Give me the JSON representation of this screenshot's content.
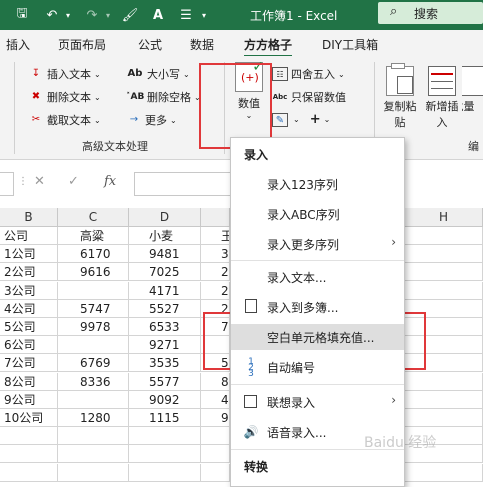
{
  "titlebar": {
    "title": "工作簿1 - Excel",
    "search_label": "搜索",
    "icons": [
      "save-icon",
      "undo-icon",
      "redo-icon",
      "format-painter-icon",
      "text-icon",
      "customize-icon"
    ]
  },
  "tabs": [
    "插入",
    "页面布局",
    "公式",
    "数据",
    "方方格子",
    "DIY工具箱"
  ],
  "ribbon": {
    "text_group": {
      "insert_text": "插入文本",
      "delete_text": "删除文本",
      "truncate_text": "截取文本",
      "case": "大小写",
      "delete_space": "删除空格",
      "more": "更多",
      "label": "高级文本处理"
    },
    "number_group": {
      "numeric": "数值",
      "round": "四舍五入",
      "keep_numeric": "只保留数值"
    },
    "copy_paste": "复制粘贴",
    "new_insert": "新增插入",
    "batch": "批量",
    "edit_label": "编"
  },
  "formula_bar": {
    "fx": "fx"
  },
  "grid": {
    "columns": [
      "B",
      "C",
      "D",
      "",
      "H"
    ],
    "rows": [
      [
        "公司",
        "高粱",
        "小麦",
        "玉"
      ],
      [
        "1公司",
        "6170",
        "9481",
        "3"
      ],
      [
        "2公司",
        "9616",
        "7025",
        "2"
      ],
      [
        "3公司",
        "",
        "4171",
        "2"
      ],
      [
        "4公司",
        "5747",
        "5527",
        "2"
      ],
      [
        "5公司",
        "9978",
        "6533",
        "7"
      ],
      [
        "6公司",
        "",
        "9271",
        ""
      ],
      [
        "7公司",
        "6769",
        "3535",
        "5"
      ],
      [
        "8公司",
        "8336",
        "5577",
        "8"
      ],
      [
        "9公司",
        "",
        "9092",
        "4"
      ],
      [
        "10公司",
        "1280",
        "1115",
        "9"
      ]
    ]
  },
  "menu": {
    "header_input": "录入",
    "items": [
      {
        "label": "录入123序列",
        "icon": ""
      },
      {
        "label": "录入ABC序列",
        "icon": ""
      },
      {
        "label": "录入更多序列",
        "icon": "",
        "submenu": true
      },
      {
        "label": "录入文本...",
        "icon": ""
      },
      {
        "label": "录入到多簿...",
        "icon": "workbook-icon"
      },
      {
        "label": "空白单元格填充值...",
        "icon": "",
        "highlight": true
      },
      {
        "label": "自动编号",
        "icon": "numbering-icon"
      },
      {
        "label": "联想录入",
        "icon": "lookup-icon",
        "submenu": true
      },
      {
        "label": "语音录入...",
        "icon": "speaker-icon"
      }
    ],
    "header_convert": "转换"
  },
  "watermark": "Baidu 经验",
  "colors": {
    "titlebar": "#217346",
    "highlight": "#e0383a",
    "hover": "#dedede"
  }
}
